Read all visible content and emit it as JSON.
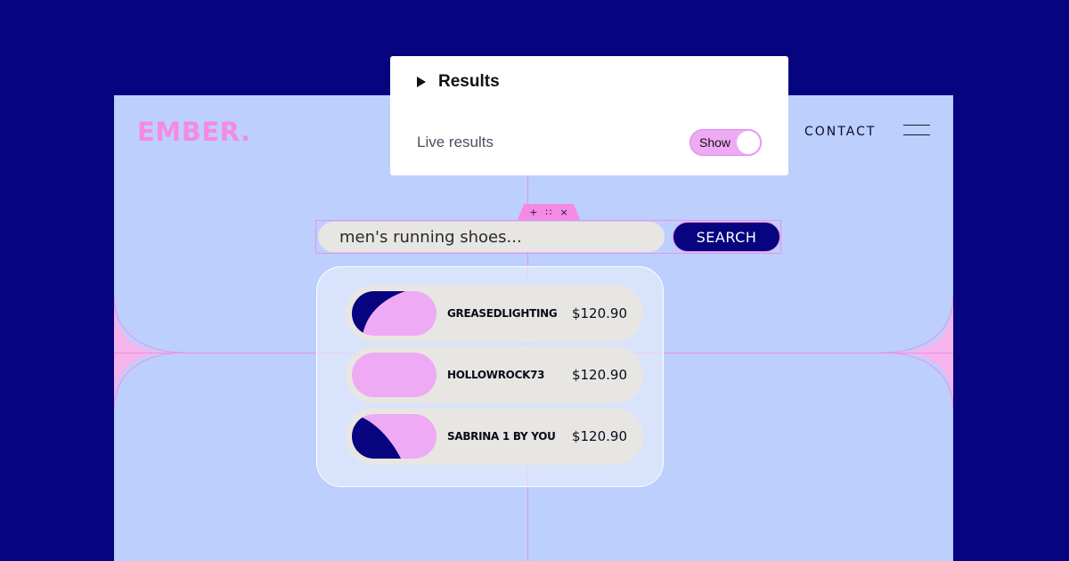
{
  "brand": {
    "logo_text": "EMBER.",
    "logo_color": "#f58ae6"
  },
  "nav": {
    "contact_label": "CONTACT",
    "menu_icon": "hamburger-icon"
  },
  "editor_toolbar": {
    "add_icon": "+",
    "drag_icon": "∷",
    "close_icon": "×"
  },
  "search": {
    "input_text": "men's running shoes...",
    "button_label": "SEARCH"
  },
  "results": [
    {
      "name": "GREASEDLIGHTING",
      "price": "$120.90",
      "thumb": "diagonal"
    },
    {
      "name": "HOLLOWROCK73",
      "price": "$120.90",
      "thumb": "plain"
    },
    {
      "name": "SABRINA 1 BY YOU",
      "price": "$120.90",
      "thumb": "curve"
    }
  ],
  "popup": {
    "title": "Results",
    "live_label": "Live results",
    "toggle_label": "Show"
  },
  "colors": {
    "background": "#06047f",
    "site": "#bccffd",
    "accent_pink": "#f58ae6",
    "navy": "#06047f"
  }
}
